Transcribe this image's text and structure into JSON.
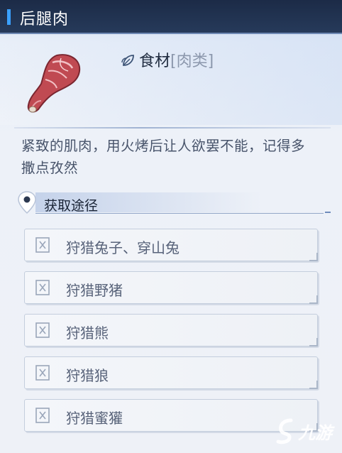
{
  "window": {
    "title": "后腿肉"
  },
  "item": {
    "icon": "meat-leg-icon",
    "category_label": "食材",
    "category_sub": "[肉类]",
    "category_icon": "leaf-icon",
    "description": "紧致的肌肉，用火烤后让人欲罢不能，记得多撒点孜然"
  },
  "sources": {
    "header": "获取途径",
    "header_icon": "location-pin-icon",
    "items": [
      {
        "label": "狩猎兔子、穿山兔",
        "icon": "hunt-icon"
      },
      {
        "label": "狩猎野猪",
        "icon": "hunt-icon"
      },
      {
        "label": "狩猎熊",
        "icon": "hunt-icon"
      },
      {
        "label": "狩猎狼",
        "icon": "hunt-icon"
      },
      {
        "label": "狩猎蜜獾",
        "icon": "hunt-icon"
      }
    ]
  },
  "watermark": {
    "text": "九游"
  },
  "colors": {
    "title_bar": "#1c2b47",
    "accent": "#3aa0ff",
    "meat": "#c04a52"
  }
}
